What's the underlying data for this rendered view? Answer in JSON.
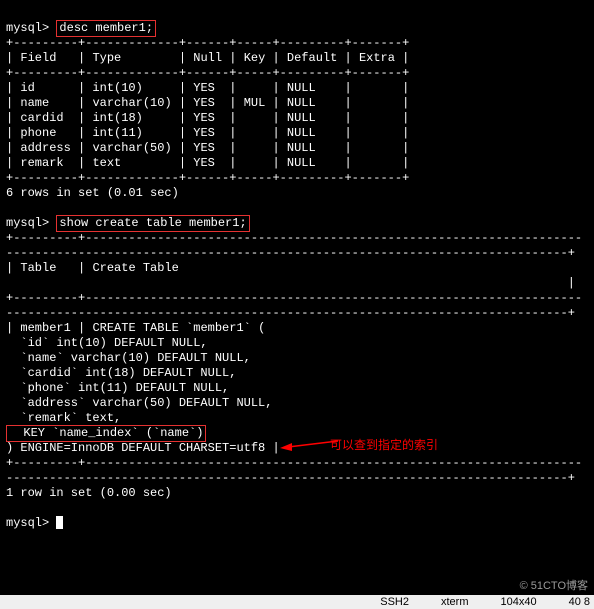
{
  "prompt": "mysql>",
  "commands": {
    "desc": "desc member1;",
    "showCreate": "show create table member1;"
  },
  "descTable": {
    "header": {
      "field": "Field",
      "type": "Type",
      "null": "Null",
      "key": "Key",
      "default": "Default",
      "extra": "Extra"
    },
    "rows": [
      {
        "field": "id",
        "type": "int(10)",
        "null": "YES",
        "key": "",
        "default": "NULL",
        "extra": ""
      },
      {
        "field": "name",
        "type": "varchar(10)",
        "null": "YES",
        "key": "MUL",
        "default": "NULL",
        "extra": ""
      },
      {
        "field": "cardid",
        "type": "int(18)",
        "null": "YES",
        "key": "",
        "default": "NULL",
        "extra": ""
      },
      {
        "field": "phone",
        "type": "int(11)",
        "null": "YES",
        "key": "",
        "default": "NULL",
        "extra": ""
      },
      {
        "field": "address",
        "type": "varchar(50)",
        "null": "YES",
        "key": "",
        "default": "NULL",
        "extra": ""
      },
      {
        "field": "remark",
        "type": "text",
        "null": "YES",
        "key": "",
        "default": "NULL",
        "extra": ""
      }
    ],
    "footer": "6 rows in set (0.01 sec)"
  },
  "createTable": {
    "header": {
      "table": "Table",
      "ddl": "Create Table"
    },
    "tableName": "member1",
    "ddl": {
      "open": "CREATE TABLE `member1` (",
      "lines": [
        "  `id` int(10) DEFAULT NULL,",
        "  `name` varchar(10) DEFAULT NULL,",
        "  `cardid` int(18) DEFAULT NULL,",
        "  `phone` int(11) DEFAULT NULL,",
        "  `address` varchar(50) DEFAULT NULL,",
        "  `remark` text,"
      ],
      "keyLine": "  KEY `name_index` (`name`)",
      "close": ") ENGINE=InnoDB DEFAULT CHARSET=utf8 |"
    },
    "footer": "1 row in set (0.00 sec)"
  },
  "annotation": "可以查到指定的索引",
  "watermark": "© 51CTO博客",
  "statusbar": {
    "proto": "SSH2",
    "term": "xterm",
    "size": "104x40",
    "extra": "40 8"
  },
  "sep": {
    "descHr": "+---------+-------------+------+-----+---------+-------+",
    "longDot": "------------------------------------------------------------------------------+",
    "dashRow": "---------+---------------------------------------------------------------------"
  }
}
